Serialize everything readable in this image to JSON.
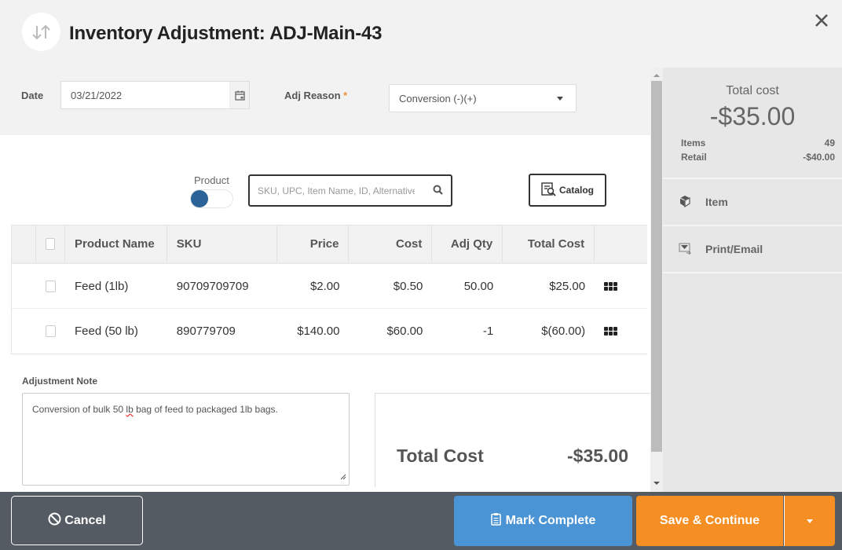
{
  "header": {
    "title": "Inventory Adjustment: ADJ-Main-43",
    "icon": "swap-vertical-icon",
    "close_icon": "close-icon"
  },
  "form": {
    "date_label": "Date",
    "date_value": "03/21/2022",
    "reason_label": "Adj Reason",
    "reason_required_mark": "*",
    "reason_value": "Conversion (-)(+)"
  },
  "search": {
    "toggle_label": "Product",
    "toggle_on": false,
    "placeholder": "SKU, UPC, Item Name, ID, Alternative",
    "catalog_label": "Catalog"
  },
  "table": {
    "columns": [
      "Product Name",
      "SKU",
      "Price",
      "Cost",
      "Adj Qty",
      "Total Cost"
    ],
    "rows": [
      {
        "name": "Feed (1lb)",
        "sku": "90709709709",
        "price": "$2.00",
        "cost": "$0.50",
        "adj_qty": "50.00",
        "total_cost": "$25.00"
      },
      {
        "name": "Feed (50 lb)",
        "sku": "890779709",
        "price": "$140.00",
        "cost": "$60.00",
        "adj_qty": "-1",
        "total_cost": "$(60.00)"
      }
    ]
  },
  "note": {
    "label": "Adjustment Note",
    "text_before": "Conversion of bulk 50 ",
    "text_misspelled": "lb",
    "text_after": " bag of feed to packaged 1lb bags."
  },
  "totals": {
    "label": "Total Cost",
    "value": "-$35.00"
  },
  "side": {
    "title": "Total cost",
    "value": "-$35.00",
    "items_label": "Items",
    "items_value": "49",
    "retail_label": "Retail",
    "retail_value": "-$40.00",
    "menu": [
      {
        "label": "Item",
        "icon": "box-icon"
      },
      {
        "label": "Print/Email",
        "icon": "print-email-icon"
      }
    ]
  },
  "footer": {
    "cancel_label": "Cancel",
    "mark_complete_label": "Mark Complete",
    "save_label": "Save & Continue"
  },
  "colors": {
    "primary_blue": "#4a93d4",
    "save_orange": "#f58f23",
    "footer_bg": "#555b63",
    "toggle_blue": "#2b6298"
  }
}
